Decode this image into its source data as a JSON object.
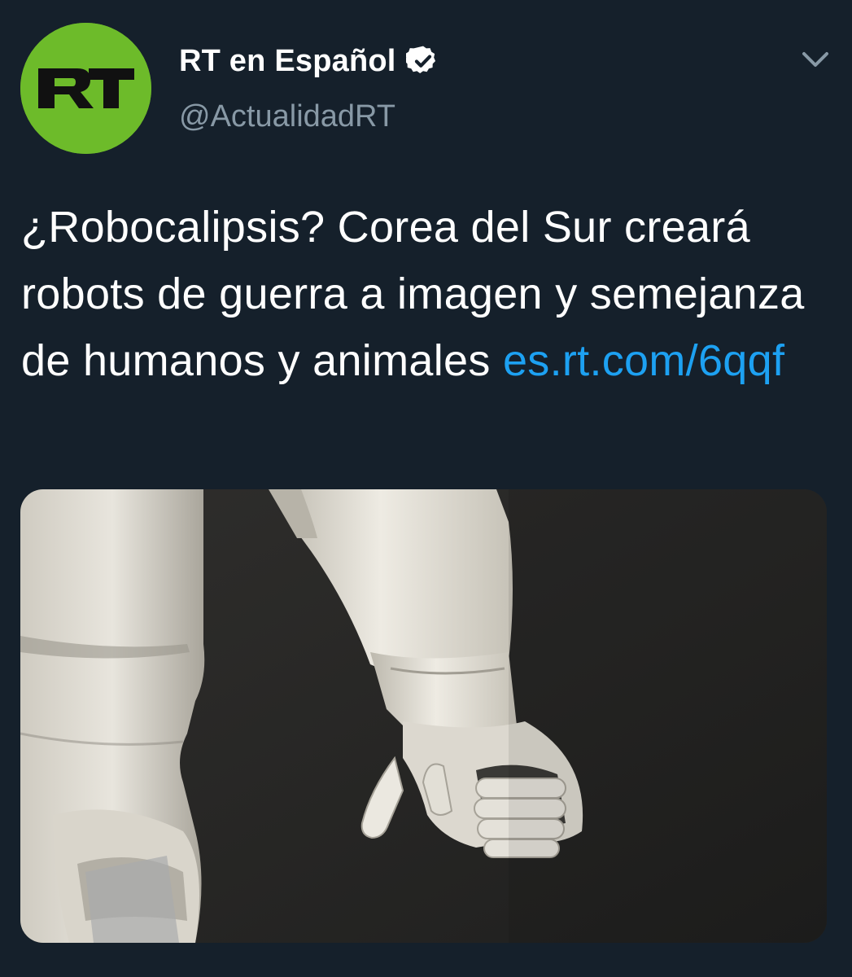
{
  "account": {
    "display_name": "RT en Español",
    "handle": "@ActualidadRT",
    "verified": true,
    "avatar_text": "RT",
    "avatar_color": "#6dbb2a"
  },
  "icons": {
    "verified": "verified-badge-icon",
    "more": "chevron-down-icon"
  },
  "tweet": {
    "text": "¿Robocalipsis? Corea del Sur creará robots de guerra a imagen y semejanza de humanos y animales",
    "link": "es.rt.com/6qqf"
  },
  "media": {
    "alt": "robot-hand-photo"
  },
  "colors": {
    "background": "#15202b",
    "link": "#1da1f2",
    "secondary_text": "#8899a6"
  }
}
